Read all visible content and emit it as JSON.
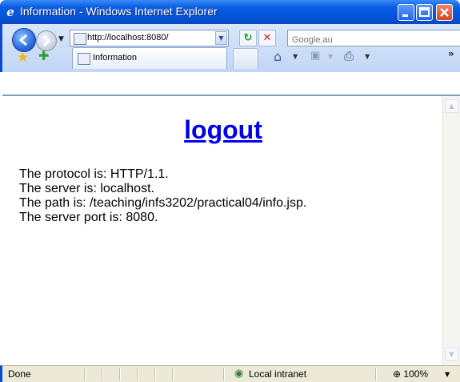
{
  "window": {
    "title": "Information - Windows Internet Explorer",
    "title_icon": "ie-logo-icon"
  },
  "toolbar": {
    "address": "http://localhost:8080/",
    "search_placeholder": "Google,au",
    "tab_label": "Information"
  },
  "page": {
    "logout_link": "logout",
    "lines": [
      "The protocol is: HTTP/1.1.",
      "The server is: localhost.",
      "The path is: /teaching/infs3202/practical04/info.jsp.",
      "The server port is: 8080."
    ]
  },
  "statusbar": {
    "status": "Done",
    "zone": "Local intranet",
    "zoom": "100%"
  },
  "colors": {
    "titlebar": "#0a5ee0",
    "link": "#0000ee",
    "statusbar": "#ece9d8"
  }
}
